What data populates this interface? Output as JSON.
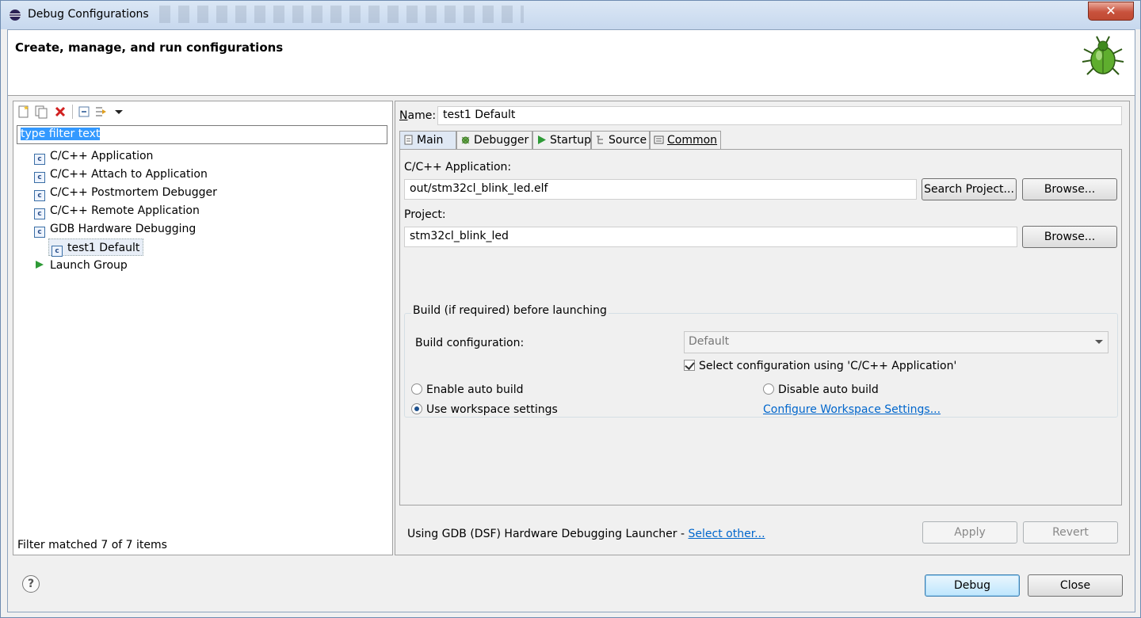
{
  "window": {
    "title": "Debug Configurations",
    "close_label": "✕"
  },
  "banner": {
    "title": "Create, manage, and run configurations"
  },
  "left": {
    "toolbar_icons": [
      "new-configuration-icon",
      "duplicate-icon",
      "delete-icon",
      "collapse-all-icon",
      "filter-icon",
      "view-menu-icon"
    ],
    "filter_text": "type filter text",
    "tree": [
      {
        "label": "C/C++ Application",
        "level": 1,
        "icon": "c-config-icon"
      },
      {
        "label": "C/C++ Attach to Application",
        "level": 1,
        "icon": "c-config-icon"
      },
      {
        "label": "C/C++ Postmortem Debugger",
        "level": 1,
        "icon": "c-config-icon"
      },
      {
        "label": "C/C++ Remote Application",
        "level": 1,
        "icon": "c-config-icon"
      },
      {
        "label": "GDB Hardware Debugging",
        "level": 1,
        "icon": "c-config-icon"
      },
      {
        "label": "test1 Default",
        "level": 2,
        "icon": "c-config-icon",
        "selected": true
      },
      {
        "label": "Launch Group",
        "level": 1,
        "icon": "launch-group-icon"
      }
    ],
    "status": "Filter matched 7 of 7 items"
  },
  "right": {
    "name_label": "ame:",
    "name_label_mnemonic": "N",
    "name_value": "test1 Default",
    "tabs": [
      {
        "label": "Main",
        "icon": "main-tab-icon",
        "active": true
      },
      {
        "label": "Debugger",
        "icon": "debugger-tab-icon"
      },
      {
        "label": "Startup",
        "icon": "startup-tab-icon"
      },
      {
        "label": "Source",
        "icon": "source-tab-icon"
      },
      {
        "label": "Common",
        "icon": "common-tab-icon"
      }
    ],
    "app_label": "C/C++ Application:",
    "app_value": "out/stm32cl_blink_led.elf",
    "search_project_label": "Search Project...",
    "browse_label": "Browse...",
    "project_label": "Project:",
    "project_value": "stm32cl_blink_led",
    "browse2_label": "Browse...",
    "build_group_title": "Build (if required) before launching",
    "build_config_label": "Build configuration:",
    "build_config_value": "Default",
    "select_config_label": "Select configuration using 'C/C++ Application'",
    "select_config_checked": true,
    "enable_auto_build_label": "Enable auto build",
    "disable_auto_build_label": "Disable auto build",
    "use_workspace_label": "Use workspace settings",
    "configure_workspace_link": "Configure Workspace Settings...",
    "launcher_text": "Using GDB (DSF) Hardware Debugging Launcher - ",
    "select_other_link": "Select other...",
    "apply_label": "Apply",
    "revert_label": "Revert"
  },
  "footer": {
    "help_label": "?",
    "debug_label": "Debug",
    "close_label": "Close"
  },
  "colors": {
    "selection": "#3399ff",
    "link": "#0066cc",
    "title_bar": "#c7d8ee",
    "close_button": "#c8523d"
  }
}
